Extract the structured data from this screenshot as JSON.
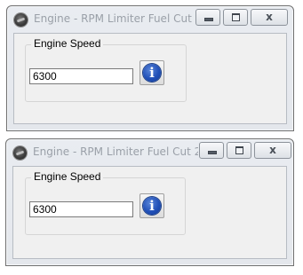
{
  "windows": [
    {
      "title": "Engine - RPM Limiter Fuel Cut ...",
      "group_label": "Engine Speed",
      "value": "6300",
      "info_glyph": "i",
      "close_glyph": "x"
    },
    {
      "title": "Engine - RPM Limiter Fuel Cut 2 ...",
      "group_label": "Engine Speed",
      "value": "6300",
      "info_glyph": "i",
      "close_glyph": "x"
    }
  ],
  "icons": {
    "app": "engine-app-icon",
    "minimize": "minimize-icon",
    "maximize": "maximize-icon",
    "close": "close-icon",
    "info": "info-icon"
  },
  "colors": {
    "title_text": "#9aa0a8",
    "info_blue": "#2150b8",
    "client_bg": "#f0f0f0"
  }
}
